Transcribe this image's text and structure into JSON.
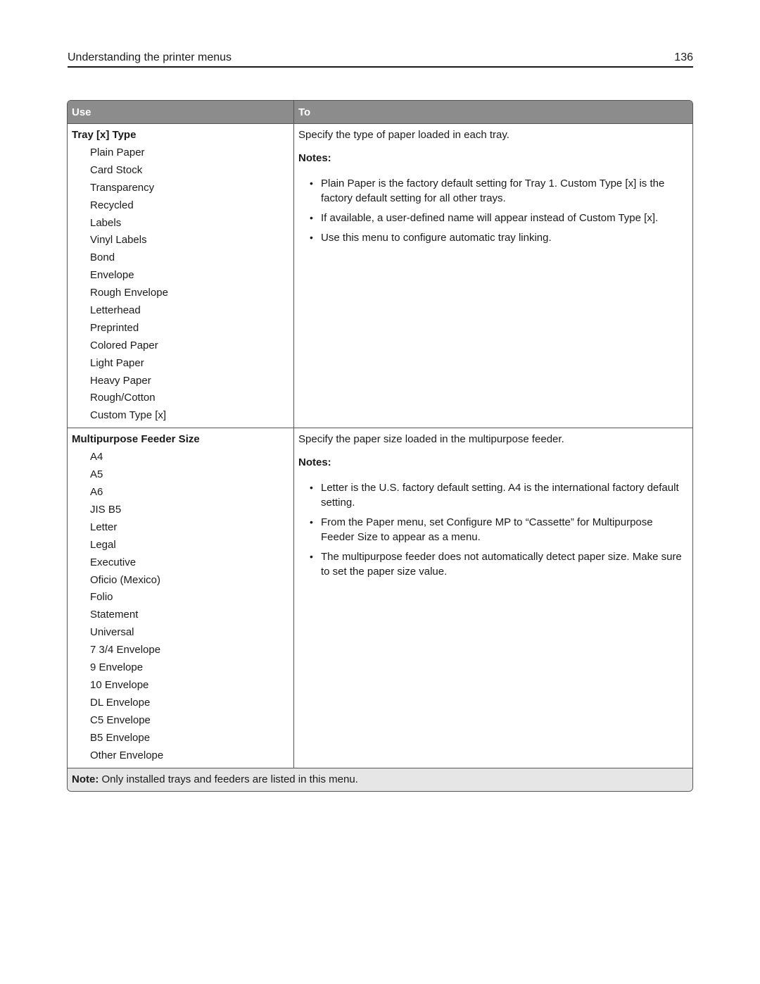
{
  "header": {
    "title": "Understanding the printer menus",
    "page_number": "136"
  },
  "table": {
    "columns": {
      "use": "Use",
      "to": "To"
    },
    "rows": [
      {
        "setting": "Tray [x] Type",
        "options": [
          "Plain Paper",
          "Card Stock",
          "Transparency",
          "Recycled",
          "Labels",
          "Vinyl Labels",
          "Bond",
          "Envelope",
          "Rough Envelope",
          "Letterhead",
          "Preprinted",
          "Colored Paper",
          "Light Paper",
          "Heavy Paper",
          "Rough/Cotton",
          "Custom Type [x]"
        ],
        "description": "Specify the type of paper loaded in each tray.",
        "notes_label": "Notes:",
        "notes": [
          "Plain Paper is the factory default setting for Tray 1. Custom Type [x] is the factory default setting for all other trays.",
          "If available, a user-defined name will appear instead of Custom Type [x].",
          "Use this menu to configure automatic tray linking."
        ]
      },
      {
        "setting": "Multipurpose Feeder Size",
        "options": [
          "A4",
          "A5",
          "A6",
          "JIS B5",
          "Letter",
          "Legal",
          "Executive",
          "Oficio (Mexico)",
          "Folio",
          "Statement",
          "Universal",
          "7 3/4 Envelope",
          "9 Envelope",
          "10 Envelope",
          "DL Envelope",
          "C5 Envelope",
          "B5 Envelope",
          "Other Envelope"
        ],
        "description": "Specify the paper size loaded in the multipurpose feeder.",
        "notes_label": "Notes:",
        "notes": [
          "Letter is the U.S. factory default setting. A4 is the international factory default setting.",
          "From the Paper menu, set Configure MP to “Cassette” for Multipurpose Feeder Size to appear as a menu.",
          "The multipurpose feeder does not automatically detect paper size. Make sure to set the paper size value."
        ]
      }
    ],
    "footer": {
      "label": "Note:",
      "text": " Only installed trays and feeders are listed in this menu."
    }
  },
  "icons": {
    "bullet": "•"
  }
}
